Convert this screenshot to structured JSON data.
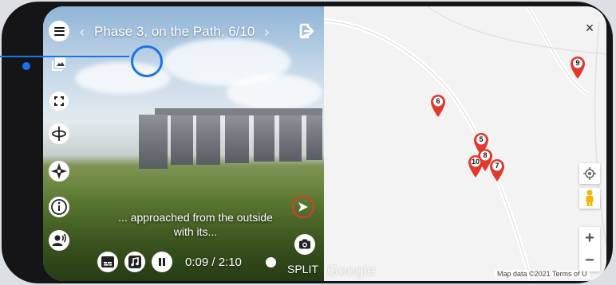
{
  "header": {
    "prev_chevron": "‹",
    "title": "Phase 3, on the Path, 6/10",
    "next_chevron": "›"
  },
  "icons": {
    "menu": "hamburger-menu-icon",
    "exit": "exit-icon",
    "gallery": "image-gallery-icon",
    "fullscreen": "fullscreen-icon",
    "rotate": "rotate-view-icon",
    "compass": "compass-rose-icon",
    "info": "info-icon",
    "narrator": "speaker-person-icon",
    "subtitles": "subtitles-icon",
    "music": "music-note-icon",
    "pause": "pause-icon",
    "camera": "camera-icon",
    "play_next": "play-arrow-icon",
    "close": "close-icon",
    "locate": "my-location-icon",
    "street_view": "pegman-icon"
  },
  "caption": {
    "line1": "... approached from the outside",
    "line2": "with its..."
  },
  "playback": {
    "time": "0:09 / 2:10",
    "split_label": "SPLIT"
  },
  "map": {
    "close_label": "×",
    "zoom_in": "+",
    "zoom_out": "−",
    "logo": "Google",
    "attribution": "Map data ©2021   Terms of U",
    "pin_color": "#e03a2f",
    "markers": [
      {
        "label": "9"
      },
      {
        "label": "6"
      },
      {
        "label": "5"
      },
      {
        "label": "8"
      },
      {
        "label": "10"
      },
      {
        "label": "7"
      }
    ]
  },
  "colors": {
    "accent_blue": "#1a73e8",
    "accent_red": "#e23a2e"
  }
}
